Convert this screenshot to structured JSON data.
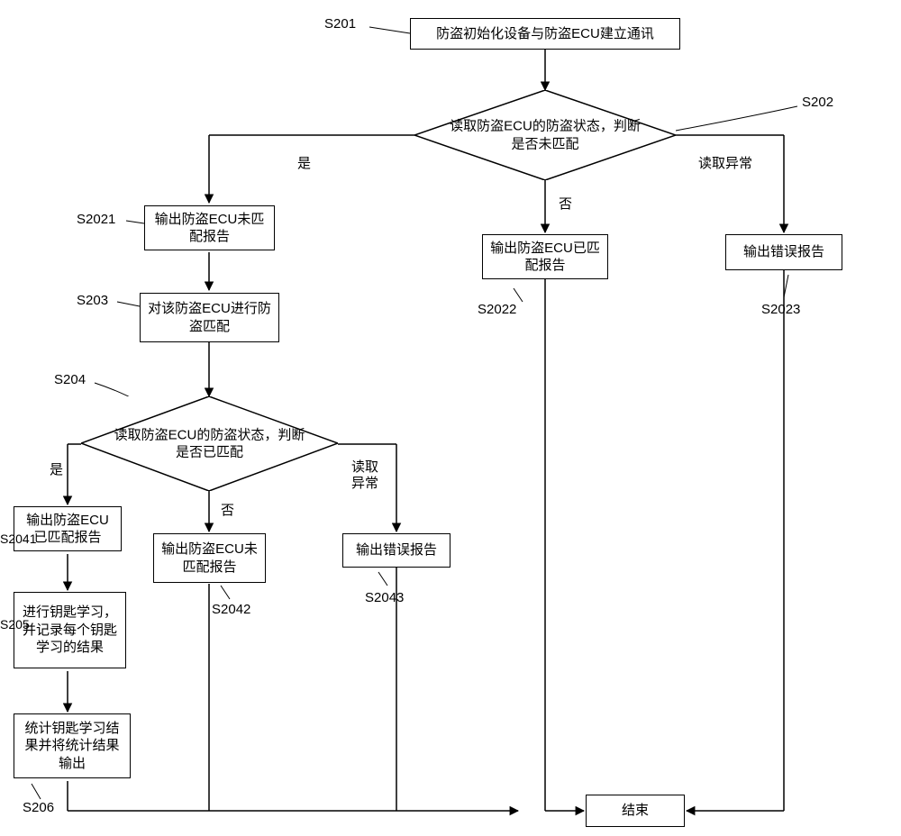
{
  "nodes": {
    "s201": "防盗初始化设备与防盗ECU建立通讯",
    "s202": "读取防盗ECU的防盗状态，判断是否未匹配",
    "s2021": "输出防盗ECU未匹配报告",
    "s2022": "输出防盗ECU已匹配报告",
    "s2023": "输出错误报告",
    "s203": "对该防盗ECU进行防盗匹配",
    "s204": "读取防盗ECU的防盗状态，判断是否已匹配",
    "s2041": "输出防盗ECU已匹配报告",
    "s2042": "输出防盗ECU未匹配报告",
    "s2043": "输出错误报告",
    "s205": "进行钥匙学习，并记录每个钥匙学习的结果",
    "s206": "统计钥匙学习结果并将统计结果输出",
    "end": "结束"
  },
  "stepLabels": {
    "s201": "S201",
    "s202": "S202",
    "s2021": "S2021",
    "s2022": "S2022",
    "s2023": "S2023",
    "s203": "S203",
    "s204": "S204",
    "s2041": "S2041",
    "s2042": "S2042",
    "s2043": "S2043",
    "s205": "S205",
    "s206": "S206"
  },
  "edgeLabels": {
    "yes": "是",
    "no": "否",
    "readError": "读取异常",
    "readError2line": "读取\n异常"
  }
}
